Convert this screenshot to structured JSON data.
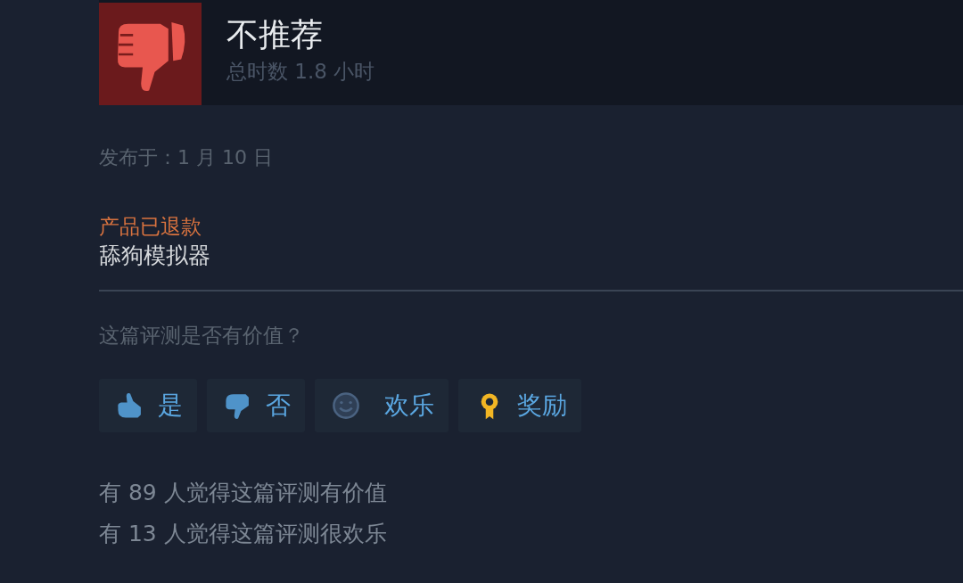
{
  "review": {
    "recommendation": "不推荐",
    "recommended": false,
    "playtime": "总时数 1.8 小时"
  },
  "posted": "发布于：1 月 10 日",
  "refund_notice": "产品已退款",
  "body": "舔狗模拟器",
  "helpful_prompt": "这篇评测是否有价值？",
  "buttons": [
    {
      "kind": "thumbs_up",
      "label": "是"
    },
    {
      "kind": "thumbs_down",
      "label": "否"
    },
    {
      "kind": "smile",
      "label": "欢乐"
    },
    {
      "kind": "award",
      "label": "奖励"
    }
  ],
  "stats": [
    "有 89 人觉得这篇评测有价值",
    "有 13 人觉得这篇评测很欢乐"
  ]
}
